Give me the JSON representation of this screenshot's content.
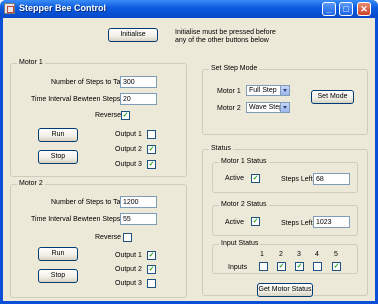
{
  "window": {
    "title": "Stepper Bee Control",
    "minimize": "_",
    "maximize": "□",
    "close": "✕"
  },
  "header": {
    "initialise_label": "Initialise",
    "note_line1": "Initialise must be pressed before",
    "note_line2": "any of the other buttons below"
  },
  "motor1": {
    "group_label": "Motor 1",
    "steps_label": "Number of Steps to Take",
    "steps_value": "300",
    "interval_label": "Time Interval Bewteen Steps (ms)",
    "interval_value": "20",
    "reverse_label": "Reverse",
    "reverse_checked": true,
    "run_label": "Run",
    "stop_label": "Stop",
    "outputs": [
      {
        "label": "Output 1",
        "checked": false
      },
      {
        "label": "Output 2",
        "checked": true
      },
      {
        "label": "Output 3",
        "checked": true
      }
    ]
  },
  "motor2": {
    "group_label": "Motor 2",
    "steps_label": "Number of Steps to Take",
    "steps_value": "1200",
    "interval_label": "Time Interval Bewteen Steps (ms)",
    "interval_value": "55",
    "reverse_label": "Reverse",
    "reverse_checked": false,
    "run_label": "Run",
    "stop_label": "Stop",
    "outputs": [
      {
        "label": "Output 1",
        "checked": true
      },
      {
        "label": "Output 2",
        "checked": true
      },
      {
        "label": "Output 3",
        "checked": false
      }
    ]
  },
  "step_mode": {
    "group_label": "Set Step Mode",
    "motor1_label": "Motor 1",
    "motor1_value": "Full Step",
    "motor2_label": "Motor 2",
    "motor2_value": "Wave Step",
    "set_mode_label": "Set Mode"
  },
  "status": {
    "group_label": "Status",
    "motor1_status": {
      "label": "Motor 1 Status",
      "active_label": "Active",
      "active_checked": true,
      "steps_left_label": "Steps Left",
      "steps_left_value": "68"
    },
    "motor2_status": {
      "label": "Motor 2 Status",
      "active_label": "Active",
      "active_checked": true,
      "steps_left_label": "Steps Left",
      "steps_left_value": "1023"
    },
    "input_status": {
      "label": "Input Status",
      "inputs_label": "Inputs",
      "columns": [
        "1",
        "2",
        "3",
        "4",
        "5"
      ],
      "checked": [
        false,
        true,
        true,
        false,
        true
      ]
    },
    "get_motor_status_label": "Get Motor Status"
  },
  "colors": {
    "titlebar": "#0a5ae0",
    "face": "#ece9d8",
    "check": "#21a121"
  }
}
